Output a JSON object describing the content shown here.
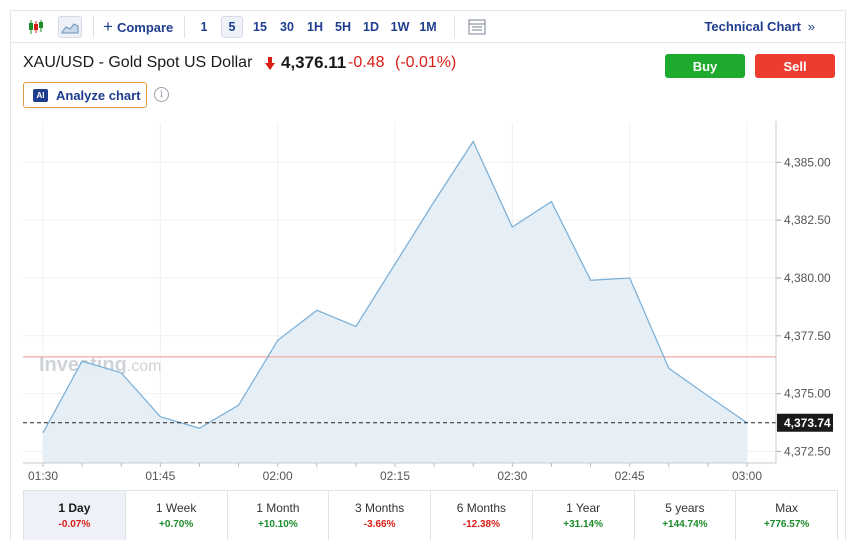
{
  "toolbar": {
    "compare_label": "Compare",
    "intervals": [
      "1",
      "5",
      "15",
      "30",
      "1H",
      "5H",
      "1D",
      "1W",
      "1M"
    ],
    "selected_interval": "5",
    "technical_chart_label": "Technical Chart",
    "technical_chart_arrow": "»"
  },
  "instrument": {
    "name": "XAU/USD - Gold Spot US Dollar",
    "price": "4,376.11",
    "change": "-0.48",
    "change_pct": "(-0.01%)",
    "direction": "down"
  },
  "actions": {
    "buy_label": "Buy",
    "sell_label": "Sell",
    "analyze_label": "Analyze chart",
    "ai_badge": "AI",
    "info_glyph": "i"
  },
  "watermark": {
    "brand": "Investing",
    "suffix": ".com"
  },
  "colors": {
    "buy": "#1eaa2c",
    "sell": "#ec3b2f",
    "line": "#7fb2d8",
    "fill": "#e6eef6",
    "negative": "#d91e18",
    "positive": "#1a8c2a",
    "link": "#1f3d8f"
  },
  "chart_data": {
    "type": "area",
    "x": [
      "01:30",
      "01:35",
      "01:40",
      "01:45",
      "01:50",
      "01:55",
      "02:00",
      "02:05",
      "02:10",
      "02:15",
      "02:20",
      "02:25",
      "02:30",
      "02:35",
      "02:40",
      "02:45",
      "02:50",
      "02:55",
      "03:00"
    ],
    "values": [
      4373.3,
      4376.4,
      4375.9,
      4374.0,
      4373.5,
      4374.5,
      4377.3,
      4378.6,
      4377.9,
      4380.6,
      4383.3,
      4385.9,
      4382.2,
      4383.3,
      4379.9,
      4380.0,
      4376.1,
      4374.9,
      4373.74
    ],
    "x_ticks": [
      "01:30",
      "01:45",
      "02:00",
      "02:15",
      "02:30",
      "02:45",
      "03:00"
    ],
    "y_ticks": [
      "4,372.50",
      "4,375.00",
      "4,377.50",
      "4,380.00",
      "4,382.50",
      "4,385.00"
    ],
    "ylim": [
      4372.0,
      4386.7
    ],
    "last_value_label": "4,373.74",
    "reference_line": 4376.59,
    "grid": true
  },
  "periods": [
    {
      "label": "1 Day",
      "value": "-0.07%",
      "sign": "neg",
      "active": true
    },
    {
      "label": "1 Week",
      "value": "+0.70%",
      "sign": "pos"
    },
    {
      "label": "1 Month",
      "value": "+10.10%",
      "sign": "pos"
    },
    {
      "label": "3 Months",
      "value": "-3.66%",
      "sign": "neg"
    },
    {
      "label": "6 Months",
      "value": "-12.38%",
      "sign": "neg"
    },
    {
      "label": "1 Year",
      "value": "+31.14%",
      "sign": "pos"
    },
    {
      "label": "5 years",
      "value": "+144.74%",
      "sign": "pos"
    },
    {
      "label": "Max",
      "value": "+776.57%",
      "sign": "pos"
    }
  ]
}
